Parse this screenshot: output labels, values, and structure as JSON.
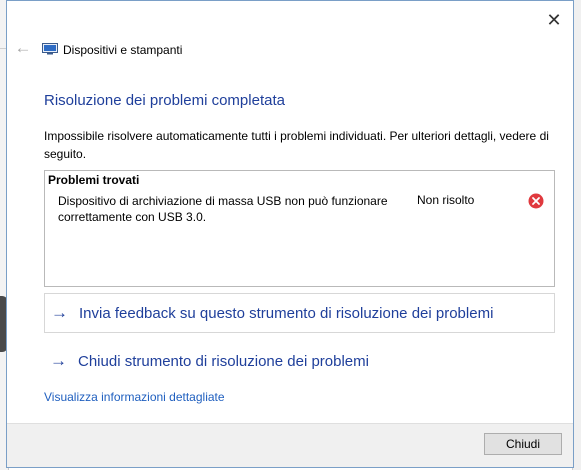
{
  "window": {
    "close_glyph": "✕"
  },
  "nav": {
    "back_glyph": "←",
    "title": "Dispositivi e stampanti"
  },
  "heading": "Risoluzione dei problemi completata",
  "description": "Impossibile risolvere automaticamente tutti i problemi individuati. Per ulteriori dettagli, vedere di seguito.",
  "problems": {
    "header": "Problemi trovati",
    "items": [
      {
        "description": "Dispositivo di archiviazione di massa USB non può funzionare correttamente con USB 3.0.",
        "status": "Non risolto",
        "status_icon": "error-icon",
        "status_color": "#e0393e"
      }
    ]
  },
  "links": {
    "arrow_glyph": "→",
    "feedback": "Invia feedback su questo strumento di risoluzione dei problemi",
    "close_troubleshooter": "Chiudi strumento di risoluzione dei problemi",
    "details": "Visualizza informazioni dettagliate"
  },
  "footer": {
    "close_button": "Chiudi"
  },
  "colors": {
    "heading": "#1f3f9b",
    "link": "#1f5fbf"
  }
}
